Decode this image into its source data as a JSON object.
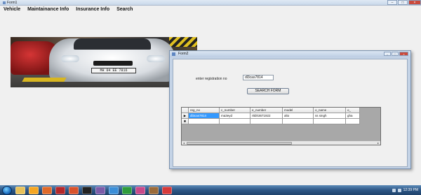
{
  "window": {
    "title": "Form1"
  },
  "menu": [
    "Vehicle",
    "Maintainance Info",
    "Insurance Info",
    "Search"
  ],
  "photo": {
    "plate_text": "MH 04 EE 7816"
  },
  "form2": {
    "title": "Form2",
    "reg_label": "enter registration no",
    "reg_value": "dl3cas7814",
    "search_button": "SEARCH FORM",
    "grid": {
      "headers": [
        "reg_no",
        "c_number",
        "e_number",
        "model",
        "o_name",
        "o_"
      ],
      "rows": [
        {
          "indicator": "▶",
          "cells": [
            "dl3cas7814",
            "ma3eyd",
            "r5bh3671922",
            "alto",
            "ss singh",
            "gha"
          ]
        },
        {
          "indicator": "✱",
          "cells": [
            "",
            "",
            "",
            "",
            "",
            ""
          ]
        }
      ]
    }
  },
  "taskbar": {
    "icons": [
      "explorer-icon",
      "media-player-icon",
      "firefox-icon",
      "acrobat-icon",
      "powerpoint-icon",
      "cmd-icon",
      "visual-studio-icon",
      "paint-icon",
      "chrome-icon",
      "tool-icon",
      "zip-icon",
      "app-icon"
    ],
    "icon_colors": [
      "#e8c15a",
      "#f5a623",
      "#e06a2a",
      "#b5282a",
      "#d9532c",
      "#222222",
      "#7b5ca8",
      "#3c8fd8",
      "#2e9c3c",
      "#c94a8a",
      "#9b6b3a",
      "#d63a3a"
    ],
    "clock": "12:39 PM"
  }
}
